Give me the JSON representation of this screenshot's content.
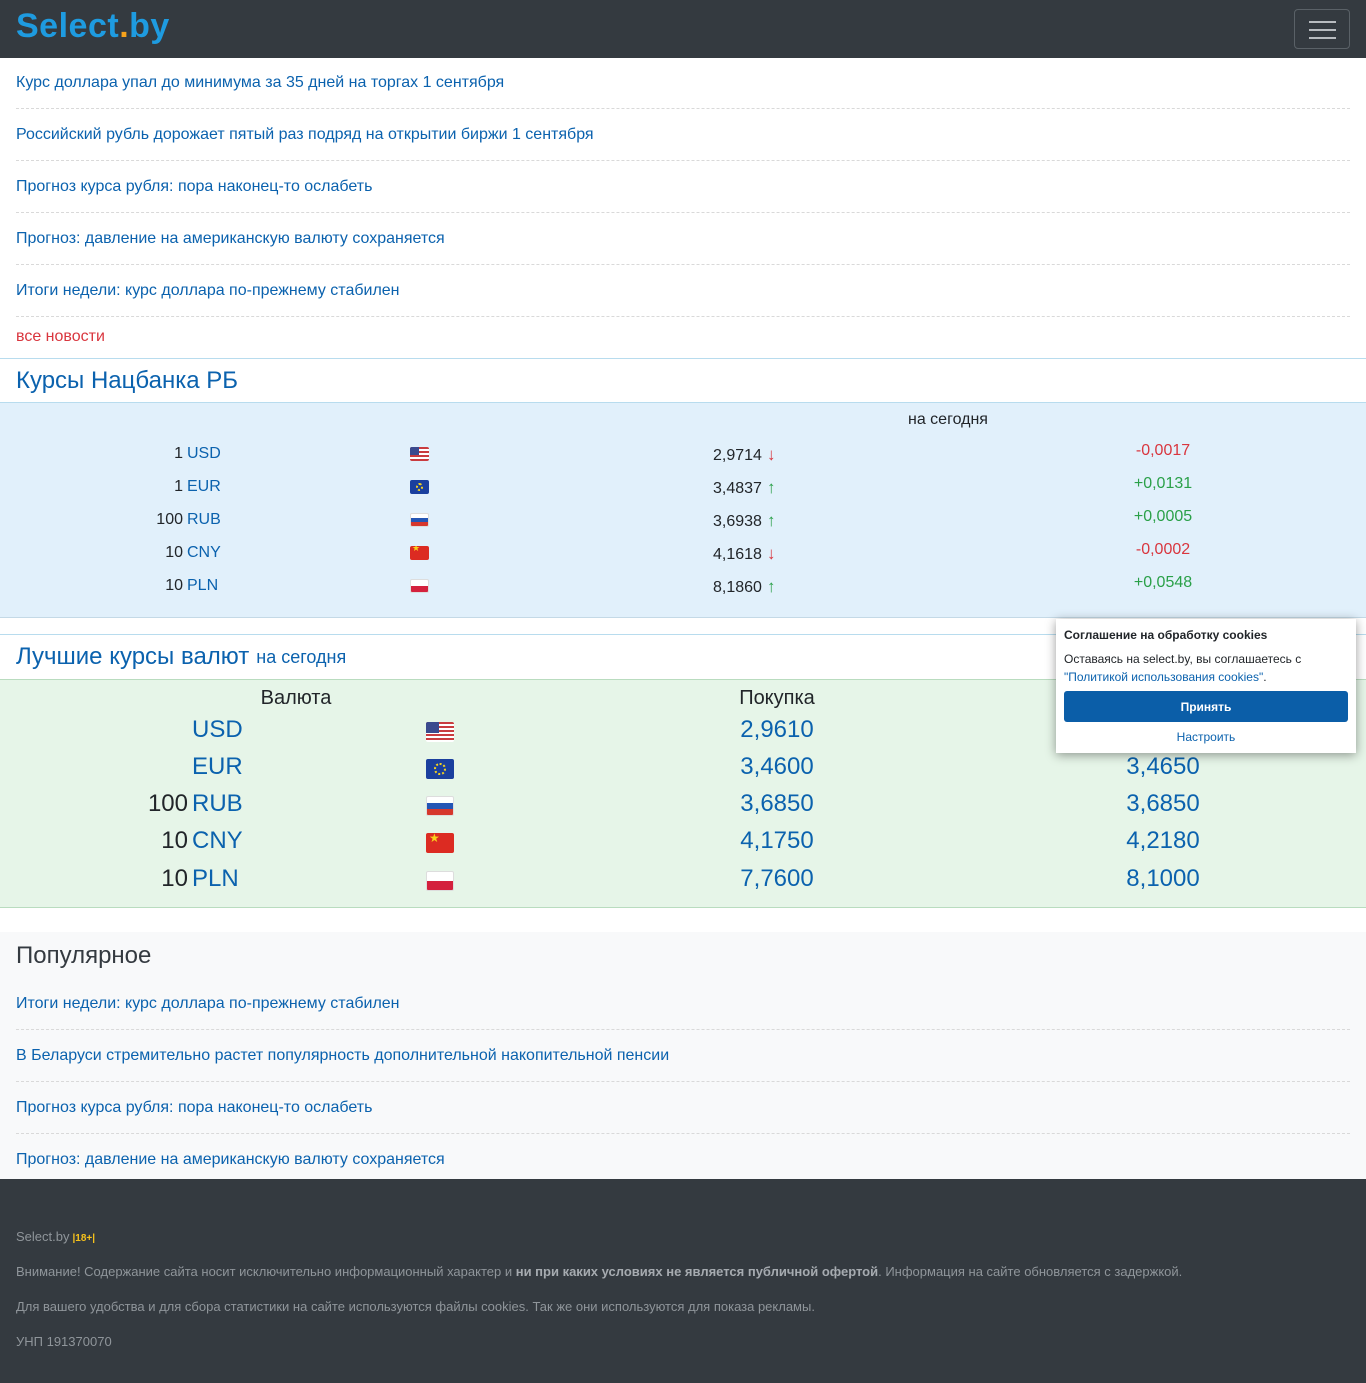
{
  "header": {
    "logo_part1": "Select",
    "logo_dot": ".",
    "logo_part2": "by",
    "menu_icon": "hamburger-icon"
  },
  "news": {
    "items": [
      "Курс доллара упал до минимума за 35 дней на торгах 1 сентября",
      "Российский рубль дорожает пятый раз подряд на открытии биржи 1 сентября",
      "Прогноз курса рубля: пора наконец-то ослабеть",
      "Прогноз: давление на американскую валюту сохраняется",
      "Итоги недели: курс доллара по-прежнему стабилен"
    ],
    "all_news": "все новости"
  },
  "nbrb": {
    "title": "Курсы Нацбанка РБ",
    "column_header": "на сегодня",
    "rows": [
      {
        "scale": "1",
        "code": "USD",
        "flag": "us-flag-icon",
        "rate": "2,9714",
        "arrow": "↓",
        "change": "-0,0017",
        "dir": "down"
      },
      {
        "scale": "1",
        "code": "EUR",
        "flag": "eu-flag-icon",
        "rate": "3,4837",
        "arrow": "↑",
        "change": "+0,0131",
        "dir": "up"
      },
      {
        "scale": "100",
        "code": "RUB",
        "flag": "ru-flag-icon",
        "rate": "3,6938",
        "arrow": "↑",
        "change": "+0,0005",
        "dir": "up"
      },
      {
        "scale": "10",
        "code": "CNY",
        "flag": "cn-flag-icon",
        "rate": "4,1618",
        "arrow": "↓",
        "change": "-0,0002",
        "dir": "down"
      },
      {
        "scale": "10",
        "code": "PLN",
        "flag": "pl-flag-icon",
        "rate": "8,1860",
        "arrow": "↑",
        "change": "+0,0548",
        "dir": "up"
      }
    ]
  },
  "best": {
    "title": "Лучшие курсы валют",
    "subtitle": "на сегодня",
    "col_currency": "Валюта",
    "col_buy": "Покупка",
    "rows": [
      {
        "scale": "",
        "code": "USD",
        "flag": "us-flag-icon",
        "buy": "2,9610",
        "sell": ""
      },
      {
        "scale": "",
        "code": "EUR",
        "flag": "eu-flag-icon",
        "buy": "3,4600",
        "sell": "3,4650"
      },
      {
        "scale": "100",
        "code": "RUB",
        "flag": "ru-flag-icon",
        "buy": "3,6850",
        "sell": "3,6850"
      },
      {
        "scale": "10",
        "code": "CNY",
        "flag": "cn-flag-icon",
        "buy": "4,1750",
        "sell": "4,2180"
      },
      {
        "scale": "10",
        "code": "PLN",
        "flag": "pl-flag-icon",
        "buy": "7,7600",
        "sell": "8,1000"
      }
    ]
  },
  "popular": {
    "title": "Популярное",
    "items": [
      "Итоги недели: курс доллара по-прежнему стабилен",
      "В Беларуси стремительно растет популярность дополнительной накопительной пенсии",
      "Прогноз курса рубля: пора наконец-то ослабеть",
      "Прогноз: давление на американскую валюту сохраняется"
    ]
  },
  "footer": {
    "site": "Select.by",
    "age": "|18+|",
    "warning_pre": "Внимание! Содержание сайта носит исключительно информационный характер и ",
    "warning_bold": "ни при каких условиях не является публичной офертой",
    "warning_post": ". Информация на сайте обновляется с задержкой.",
    "cookies_note": "Для вашего удобства и для сбора статистики на сайте используются файлы cookies. Так же они используются для показа рекламы.",
    "unp": "УНП 191370070"
  },
  "cookie_popup": {
    "title": "Соглашение на обработку cookies",
    "text_pre": "Оставаясь на select.by, вы соглашаетесь с ",
    "link": "\"Политикой использования cookies\"",
    "text_post": ".",
    "accept": "Принять",
    "settings": "Настроить"
  },
  "colors": {
    "navbar": "#343a40",
    "link": "#0b62ae",
    "down": "#d9363e",
    "up": "#2aa048",
    "nbrb_bg": "#e1f0fb",
    "best_bg": "#e6f5e8"
  }
}
